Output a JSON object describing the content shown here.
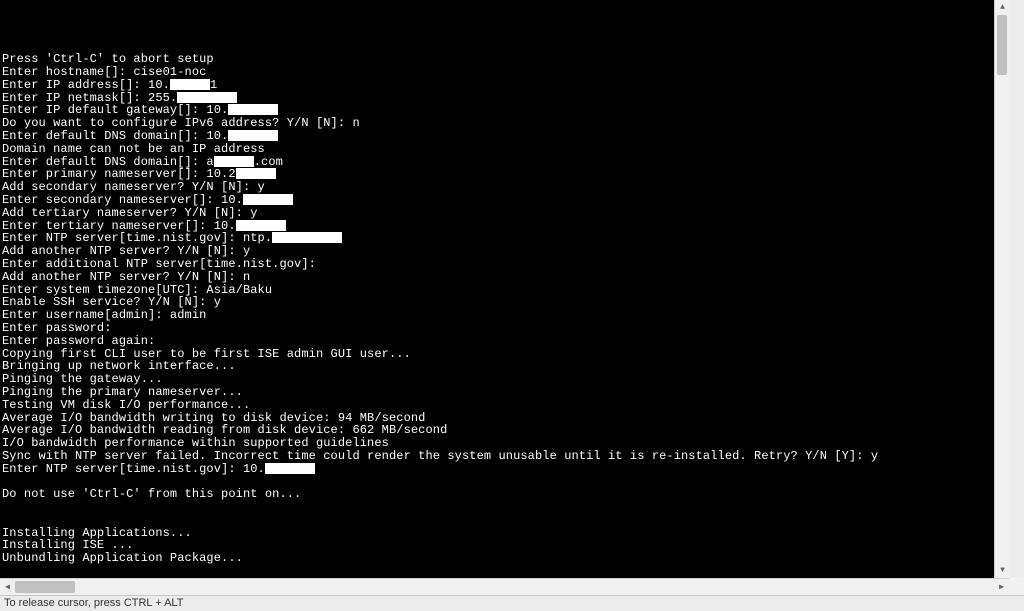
{
  "status": {
    "release_cursor": "To release cursor, press CTRL + ALT"
  },
  "redact_widths": {
    "ip_addr": 40,
    "netmask": 60,
    "gateway": 50,
    "dns1": 50,
    "dns2a": 40,
    "dns2b": 28,
    "pri_ns": 40,
    "sec_ns": 50,
    "ter_ns": 50,
    "ntp1": 70,
    "ntp2": 50
  },
  "lines": [
    {
      "t": ""
    },
    {
      "t": ""
    },
    {
      "t": ""
    },
    {
      "t": ""
    },
    {
      "t": "Press 'Ctrl-C' to abort setup"
    },
    {
      "t": "Enter hostname[]: cise01-noc"
    },
    {
      "pre": "Enter IP address[]: 10.",
      "r": "ip_addr",
      "post": "1"
    },
    {
      "pre": "Enter IP netmask[]: 255.",
      "r": "netmask",
      "post": ""
    },
    {
      "pre": "Enter IP default gateway[]: 10.",
      "r": "gateway",
      "post": ""
    },
    {
      "t": "Do you want to configure IPv6 address? Y/N [N]: n"
    },
    {
      "pre": "Enter default DNS domain[]: 10.",
      "r": "dns1",
      "post": ""
    },
    {
      "t": "Domain name can not be an IP address"
    },
    {
      "pre": "Enter default DNS domain[]: a",
      "r": "dns2a",
      "post": ".com"
    },
    {
      "pre": "Enter primary nameserver[]: 10.2",
      "r": "pri_ns",
      "post": ""
    },
    {
      "t": "Add secondary nameserver? Y/N [N]: y"
    },
    {
      "pre": "Enter secondary nameserver[]: 10.",
      "r": "sec_ns",
      "post": ""
    },
    {
      "t": "Add tertiary nameserver? Y/N [N]: y"
    },
    {
      "pre": "Enter tertiary nameserver[]: 10.",
      "r": "ter_ns",
      "post": ""
    },
    {
      "pre": "Enter NTP server[time.nist.gov]: ntp.",
      "r": "ntp1",
      "post": ""
    },
    {
      "t": "Add another NTP server? Y/N [N]: y"
    },
    {
      "t": "Enter additional NTP server[time.nist.gov]:"
    },
    {
      "t": "Add another NTP server? Y/N [N]: n"
    },
    {
      "t": "Enter system timezone[UTC]: Asia/Baku"
    },
    {
      "t": "Enable SSH service? Y/N [N]: y"
    },
    {
      "t": "Enter username[admin]: admin"
    },
    {
      "t": "Enter password:"
    },
    {
      "t": "Enter password again:"
    },
    {
      "t": "Copying first CLI user to be first ISE admin GUI user..."
    },
    {
      "t": "Bringing up network interface..."
    },
    {
      "t": "Pinging the gateway..."
    },
    {
      "t": "Pinging the primary nameserver..."
    },
    {
      "t": "Testing VM disk I/O performance..."
    },
    {
      "t": "Average I/O bandwidth writing to disk device: 94 MB/second"
    },
    {
      "t": "Average I/O bandwidth reading from disk device: 662 MB/second"
    },
    {
      "t": "I/O bandwidth performance within supported guidelines"
    },
    {
      "t": "Sync with NTP server failed. Incorrect time could render the system unusable until it is re-installed. Retry? Y/N [Y]: y"
    },
    {
      "pre": "Enter NTP server[time.nist.gov]: 10.",
      "r": "ntp2",
      "post": ""
    },
    {
      "t": ""
    },
    {
      "t": "Do not use 'Ctrl-C' from this point on..."
    },
    {
      "t": ""
    },
    {
      "t": ""
    },
    {
      "t": "Installing Applications..."
    },
    {
      "t": "Installing ISE ..."
    },
    {
      "t": "Unbundling Application Package..."
    }
  ]
}
